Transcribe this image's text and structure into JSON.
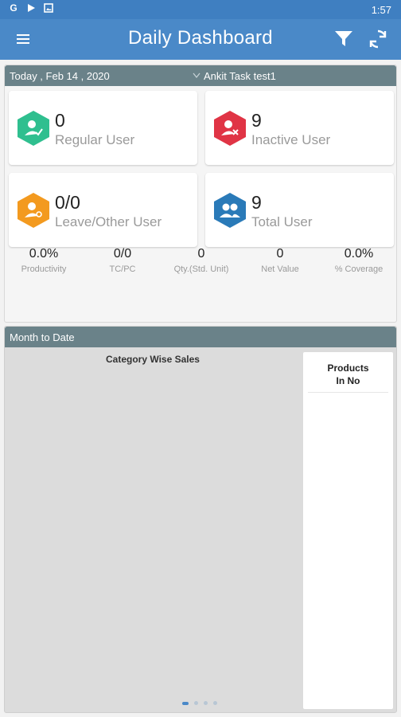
{
  "status_bar": {
    "time": "1:57",
    "icons": [
      "google-icon",
      "play-store-icon",
      "image-icon"
    ]
  },
  "app_bar": {
    "title": "Daily Dashboard",
    "icons": [
      "menu-icon",
      "filter-icon",
      "refresh-icon"
    ]
  },
  "today": {
    "date_label": "Today , Feb 14 , 2020",
    "user_selector": "Ankit Task test1",
    "cards": [
      {
        "value": "0",
        "label": "Regular User",
        "color": "#2fbf8f",
        "icon": "user-check-icon"
      },
      {
        "value": "9",
        "label": "Inactive User",
        "color": "#e03445",
        "icon": "user-remove-icon"
      },
      {
        "value": "0/0",
        "label": "Leave/Other User",
        "color": "#f39a1f",
        "icon": "user-leave-icon"
      },
      {
        "value": "9",
        "label": "Total User",
        "color": "#2a7ab8",
        "icon": "users-group-icon"
      }
    ],
    "stats": [
      {
        "value": "0.0%",
        "label": "Productivity"
      },
      {
        "value": "0/0",
        "label": "TC/PC"
      },
      {
        "value": "0",
        "label": "Qty.(Std. Unit)"
      },
      {
        "value": "0",
        "label": "Net Value"
      },
      {
        "value": "0.0%",
        "label": "% Coverage"
      }
    ]
  },
  "month_to_date": {
    "header": "Month to Date",
    "chart_title": "Category Wise Sales",
    "side_header_line1": "Products",
    "side_header_line2": "In  No",
    "pager": {
      "pages": 4,
      "active": 1
    }
  }
}
